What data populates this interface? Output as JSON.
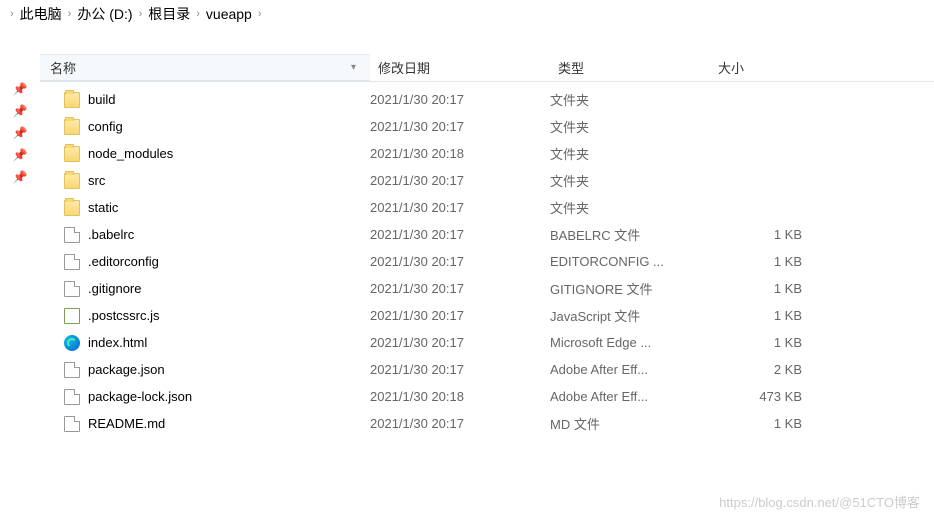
{
  "breadcrumb": [
    "此电脑",
    "办公 (D:)",
    "根目录",
    "vueapp"
  ],
  "columns": {
    "name": "名称",
    "date": "修改日期",
    "type": "类型",
    "size": "大小"
  },
  "rows": [
    {
      "icon": "folder",
      "name": "build",
      "date": "2021/1/30 20:17",
      "type": "文件夹",
      "size": ""
    },
    {
      "icon": "folder",
      "name": "config",
      "date": "2021/1/30 20:17",
      "type": "文件夹",
      "size": ""
    },
    {
      "icon": "folder",
      "name": "node_modules",
      "date": "2021/1/30 20:18",
      "type": "文件夹",
      "size": ""
    },
    {
      "icon": "folder",
      "name": "src",
      "date": "2021/1/30 20:17",
      "type": "文件夹",
      "size": ""
    },
    {
      "icon": "folder",
      "name": "static",
      "date": "2021/1/30 20:17",
      "type": "文件夹",
      "size": ""
    },
    {
      "icon": "file",
      "name": ".babelrc",
      "date": "2021/1/30 20:17",
      "type": "BABELRC 文件",
      "size": "1 KB"
    },
    {
      "icon": "file",
      "name": ".editorconfig",
      "date": "2021/1/30 20:17",
      "type": "EDITORCONFIG ...",
      "size": "1 KB"
    },
    {
      "icon": "file",
      "name": ".gitignore",
      "date": "2021/1/30 20:17",
      "type": "GITIGNORE 文件",
      "size": "1 KB"
    },
    {
      "icon": "js",
      "name": ".postcssrc.js",
      "date": "2021/1/30 20:17",
      "type": "JavaScript 文件",
      "size": "1 KB"
    },
    {
      "icon": "edge",
      "name": "index.html",
      "date": "2021/1/30 20:17",
      "type": "Microsoft Edge ...",
      "size": "1 KB"
    },
    {
      "icon": "file",
      "name": "package.json",
      "date": "2021/1/30 20:17",
      "type": "Adobe After Eff...",
      "size": "2 KB"
    },
    {
      "icon": "file",
      "name": "package-lock.json",
      "date": "2021/1/30 20:18",
      "type": "Adobe After Eff...",
      "size": "473 KB"
    },
    {
      "icon": "file",
      "name": "README.md",
      "date": "2021/1/30 20:17",
      "type": "MD 文件",
      "size": "1 KB"
    }
  ],
  "watermark": "https://blog.csdn.net/@51CTO博客"
}
